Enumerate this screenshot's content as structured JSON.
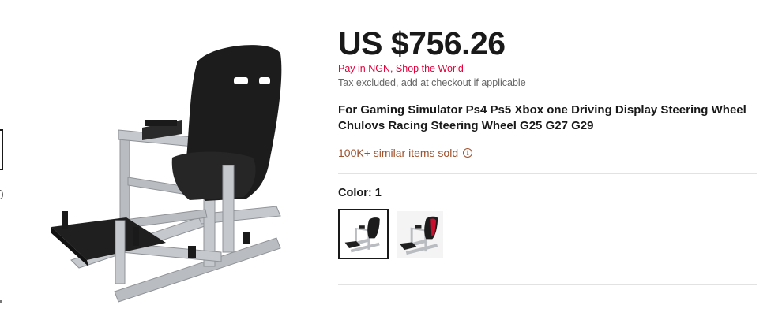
{
  "product": {
    "price": "US $756.26",
    "pay_notice": "Pay in NGN, Shop the World",
    "tax_notice": "Tax excluded, add at checkout if applicable",
    "title": "For Gaming Simulator Ps4 Ps5 Xbox one Driving Display Steering Wheel Chulovs Racing Steering Wheel G25 G27 G29",
    "sold_text": "100K+ similar items sold",
    "info_icon": "i"
  },
  "color": {
    "label": "Color: 1",
    "options": [
      {
        "name": "black-seat",
        "selected": true
      },
      {
        "name": "red-black-seat",
        "selected": false
      }
    ]
  },
  "colors": {
    "price_text": "#191919",
    "pay_notice": "#e3003b",
    "sold_text": "#a0522d",
    "frame_silver": "#b9bcc0",
    "seat_black": "#1c1c1c",
    "accent_red": "#c8102e"
  }
}
